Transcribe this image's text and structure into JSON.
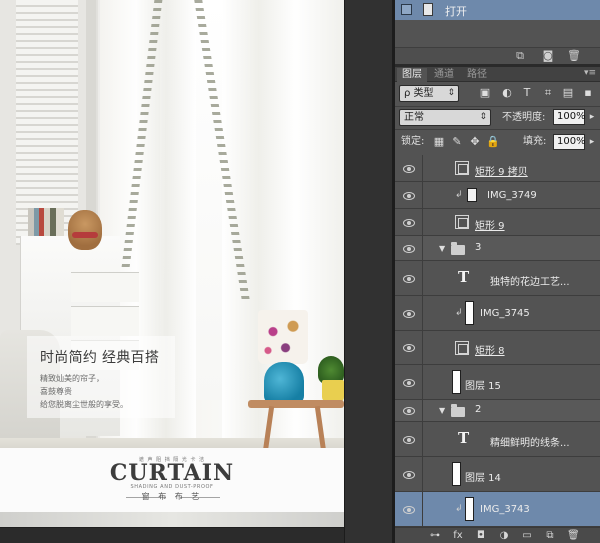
{
  "canvas": {
    "slogan": "时尚简约 经典百搭",
    "slogan_lines": [
      "精致灿美的帘子，",
      "喜鼓尊贵",
      "给您脱离尘世般的享受。"
    ],
    "brand_tagline": "遮 声 阻 挡 隔 光 卡 洁",
    "brand_title": "CURTAIN",
    "brand_subtitle": "SHADING AND DUST-PROOF",
    "brand_cn": "窗 布 布 艺"
  },
  "history": {
    "item_label": "打开"
  },
  "layers_panel": {
    "tabs": [
      {
        "label": "图层",
        "active": true
      },
      {
        "label": "通道",
        "active": false
      },
      {
        "label": "路径",
        "active": false
      }
    ],
    "filter_kind": "类型",
    "blend_mode": "正常",
    "opacity_label": "不透明度:",
    "opacity_value": "100%",
    "lock_label": "锁定:",
    "fill_label": "填充:",
    "fill_value": "100%",
    "layers": [
      {
        "name": "矩形 9 拷贝",
        "kind": "shape",
        "underline": true,
        "indent": 1
      },
      {
        "name": "IMG_3749",
        "kind": "image-small",
        "underline": false,
        "indent": 2,
        "clipped": true
      },
      {
        "name": "矩形 9",
        "kind": "shape",
        "underline": true,
        "indent": 1
      },
      {
        "name": "3",
        "kind": "group",
        "underline": false,
        "indent": 0
      },
      {
        "name": "独特的花边工艺...",
        "kind": "text",
        "underline": false,
        "indent": 1
      },
      {
        "name": "IMG_3745",
        "kind": "image",
        "underline": false,
        "indent": 2,
        "clipped": true
      },
      {
        "name": "矩形 8",
        "kind": "shape",
        "underline": true,
        "indent": 1
      },
      {
        "name": "图层 15",
        "kind": "image",
        "underline": false,
        "indent": 1
      },
      {
        "name": "2",
        "kind": "group",
        "underline": false,
        "indent": 0
      },
      {
        "name": "精细鲜明的线条...",
        "kind": "text",
        "underline": false,
        "indent": 1
      },
      {
        "name": "图层 14",
        "kind": "image",
        "underline": false,
        "indent": 1
      },
      {
        "name": "IMG_3743",
        "kind": "image",
        "underline": false,
        "indent": 2,
        "clipped": true,
        "selected": true
      }
    ]
  },
  "colors": {
    "selection": "#6e89ab",
    "panel_bg": "#535353"
  }
}
